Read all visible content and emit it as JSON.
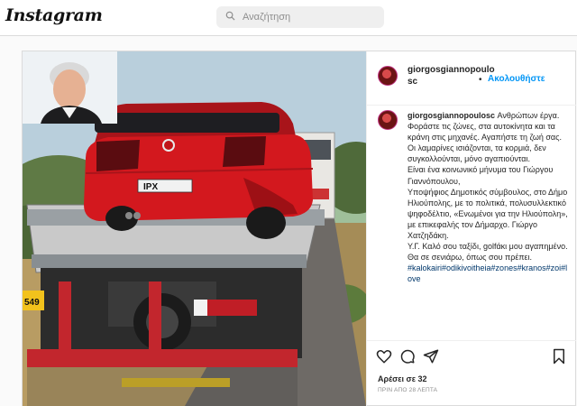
{
  "header": {
    "logo": "Instagram",
    "search_placeholder": "Αναζήτηση"
  },
  "post": {
    "username_head": "giorgosgiannopoulosc",
    "follow_label": "Ακολουθήστε",
    "separator": "•",
    "caption": {
      "username": "giorgosgiannopoulosc",
      "lines": [
        "Ανθρώπων έργα. Φοράστε τις ζώνες, στα αυτοκίνητα και τα κράνη στις μηχανές. Αγαπήστε τη ζωή σας. Οι λαμαρίνες ισιάζονται, τα κορμιά, δεν συγκολλούνται, μόνο αγαπιούνται.",
        "Είναι ένα κοινωνικό μήνυμα του Γιώργου Γιαννόπουλου,",
        "Υποψήφιος Δημοτικός σύμβουλος, στο Δήμο Ηλιούπολης, με το πολιτικά, πολυσυλλεκτικό ψηφοδέλτιο, «Ενωμένοι για την Ηλιούπολη», με επικεφαλής τον Δήμαρχο. Γιώργο Χατζηδάκη.",
        "Υ.Γ. Καλό σου ταξίδι, golfάκι μου αγαπημένο.",
        "Θα σε σενιάρω, όπως σου πρέπει."
      ],
      "hashtags": "#kalokairi#odikivoitheia#zones#kranos#zoi#love"
    },
    "likes": "Αρέσει σε 32",
    "timestamp": "ΠΡΙΝ ΑΠΟ 28 ΛΕΠΤΑ",
    "plate_text": "IPX",
    "plate_text_2": "549"
  },
  "colors": {
    "accent": "#0095f6",
    "border": "#dbdbdb",
    "text": "#262626",
    "muted": "#8e8e8e",
    "car_red": "#d3181e"
  },
  "icons": [
    "search-icon",
    "heart-icon",
    "comment-icon",
    "share-icon",
    "bookmark-icon"
  ]
}
